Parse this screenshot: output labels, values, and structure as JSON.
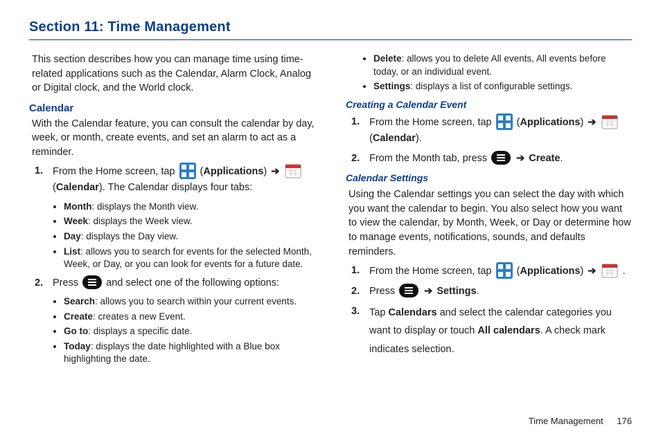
{
  "section_title": "Section 11: Time Management",
  "left": {
    "intro": "This section describes how you can manage time using time-related applications such as the Calendar, Alarm Clock, Analog or Digital clock, and the World clock.",
    "calendar_heading": "Calendar",
    "calendar_para": "With the Calendar feature, you can consult the calendar by day, week, or month, create events, and set an alarm to act as a reminder.",
    "step1": {
      "num": "1.",
      "pre": "From the Home screen, tap ",
      "apps_label_open": "(",
      "apps_label": "Applications",
      "apps_label_close": ") ",
      "arrow": "➔",
      "cal_label_open": " (",
      "cal_label": "Calendar",
      "cal_label_close": "). The Calendar displays four tabs:"
    },
    "tabs": [
      {
        "b": "Month",
        "rest": ": displays the Month view."
      },
      {
        "b": "Week",
        "rest": ": displays the Week view."
      },
      {
        "b": "Day",
        "rest": ": displays the Day view."
      },
      {
        "b": "List",
        "rest": ": allows you to search for events for the selected Month, Week, or Day, or you can look for events for a future date."
      }
    ],
    "step2": {
      "num": "2.",
      "pre": "Press ",
      "post": " and select one of the following options:"
    },
    "options": [
      {
        "b": "Search",
        "rest": ": allows you to search within your current events."
      },
      {
        "b": "Create",
        "rest": ": creates a new Event."
      },
      {
        "b": "Go to",
        "rest": ": displays a specific date."
      },
      {
        "b": "Today",
        "rest": ": displays the date highlighted with a Blue box highlighting the date."
      }
    ]
  },
  "right": {
    "options_cont": [
      {
        "b": "Delete",
        "rest": ": allows you to delete All events, All events before today, or an individual event."
      },
      {
        "b": "Settings",
        "rest": ": displays a list of configurable settings."
      }
    ],
    "creating_heading": "Creating a Calendar Event",
    "create_step1": {
      "num": "1.",
      "pre": "From the Home screen, tap ",
      "apps_label_open": "(",
      "apps_label": "Applications",
      "apps_label_close": ") ",
      "arrow": "➔",
      "cal_label_open": " (",
      "cal_label": "Calendar",
      "cal_label_close": ")."
    },
    "create_step2": {
      "num": "2.",
      "pre": "From the Month tab, press ",
      "arrow": " ➔ ",
      "create": "Create",
      "end": "."
    },
    "settings_heading": "Calendar Settings",
    "settings_para": "Using the Calendar settings you can select the day with which you want the calendar to begin. You also select how you want to view the calendar, by Month, Week, or Day or determine how to manage events, notifications, sounds, and defaults reminders.",
    "s_step1": {
      "num": "1.",
      "pre": "From the Home screen, tap ",
      "apps_label_open": "(",
      "apps_label": "Applications",
      "apps_label_close": ") ",
      "arrow": "➔",
      "end": " ."
    },
    "s_step2": {
      "num": "2.",
      "pre": "Press ",
      "arrow": " ➔ ",
      "settings": "Settings",
      "end": "."
    },
    "s_step3": {
      "num": "3.",
      "pre": "Tap ",
      "b1": "Calendars",
      "mid": " and select the calendar categories you want to display or touch ",
      "b2": "All calendars",
      "end": ". A check mark indicates selection."
    }
  },
  "footer": {
    "label": "Time Management",
    "page": "176"
  }
}
